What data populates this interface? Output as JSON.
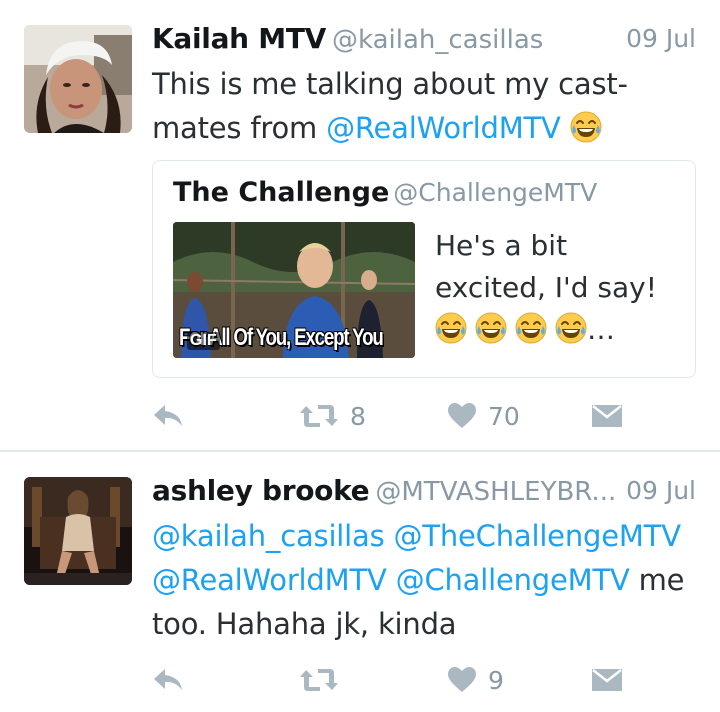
{
  "tweets": [
    {
      "display_name": "Kailah MTV",
      "handle": "@kailah_casillas",
      "timestamp": "09 Jul",
      "text_plain_1": "This is me talking about my cast-mates from ",
      "mention_1": "@RealWorldMTV",
      "quote": {
        "display_name": "The Challenge",
        "handle": "@ChallengeMTV",
        "gif_caption": "For All Of You, Except You",
        "gif_badge": "GIF",
        "text": "He's a bit excited, I'd say!",
        "text_ellipsis": "…"
      },
      "retweet_count": "8",
      "like_count": "70"
    },
    {
      "display_name": "ashley brooke",
      "handle": "@MTVASHLEYBR...",
      "timestamp": "09 Jul",
      "mentions": [
        "@kailah_casillas",
        "@TheChallengeMTV",
        "@RealWorldMTV",
        "@ChallengeMTV"
      ],
      "text_plain": " me too. Hahaha jk, kinda",
      "like_count": "9"
    }
  ],
  "icons": {
    "reply": "reply-icon",
    "retweet": "retweet-icon",
    "like": "heart-icon",
    "dm": "direct-message-icon",
    "emoji": "tears-of-joy-emoji"
  },
  "colors": {
    "link": "#1da1f2",
    "secondary_text": "#8899a6",
    "icon": "#aab8c2",
    "border": "#e1e8ed"
  }
}
